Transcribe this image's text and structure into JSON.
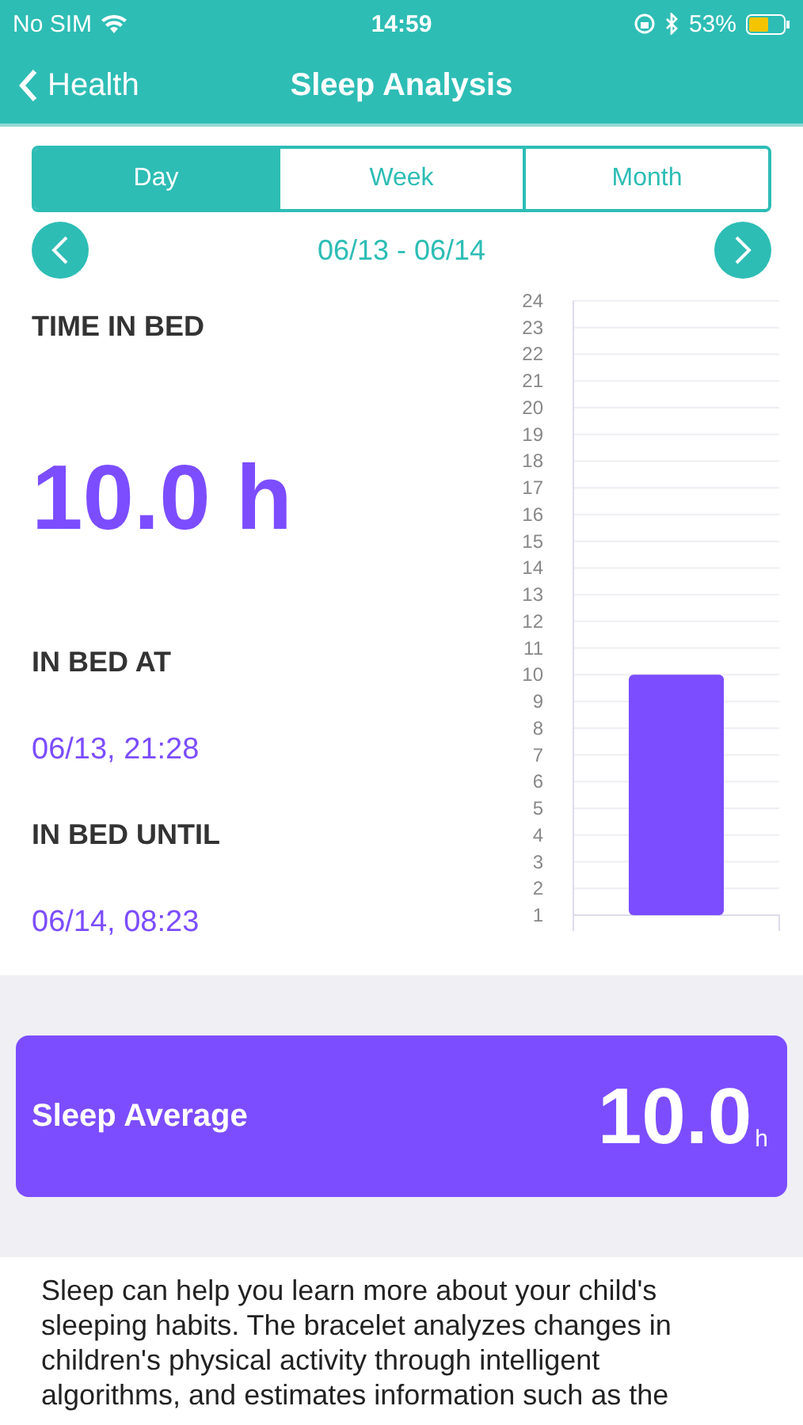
{
  "status_bar": {
    "carrier": "No SIM",
    "time": "14:59",
    "battery": "53%"
  },
  "nav": {
    "back": "Health",
    "title": "Sleep Analysis"
  },
  "tabs": [
    {
      "label": "Day",
      "selected": true
    },
    {
      "label": "Week",
      "selected": false
    },
    {
      "label": "Month",
      "selected": false
    }
  ],
  "date_range": "06/13 - 06/14",
  "stats": [
    {
      "label": "TIME IN BED",
      "value": "10.0 h",
      "kind": "big"
    },
    {
      "label": "IN BED AT",
      "value": "06/13, 21:28",
      "kind": "small"
    },
    {
      "label": "IN BED UNTIL",
      "value": "06/14, 08:23",
      "kind": "small"
    }
  ],
  "chart_data": {
    "type": "bar",
    "categories": [
      null
    ],
    "grid": true,
    "values": [
      10
    ],
    "ylim": [
      1,
      24
    ],
    "yticks": [
      1,
      2,
      3,
      4,
      5,
      6,
      7,
      8,
      9,
      10,
      11,
      12,
      13,
      14,
      15,
      16,
      17,
      18,
      19,
      20,
      21,
      22,
      23,
      24
    ]
  },
  "average": {
    "label": "Sleep Average",
    "value": "10.0",
    "unit": "h"
  },
  "description": "Sleep can help you learn more about your child's sleeping habits. The bracelet analyzes changes in children's physical activity through intelligent algorithms, and estimates information such as the"
}
